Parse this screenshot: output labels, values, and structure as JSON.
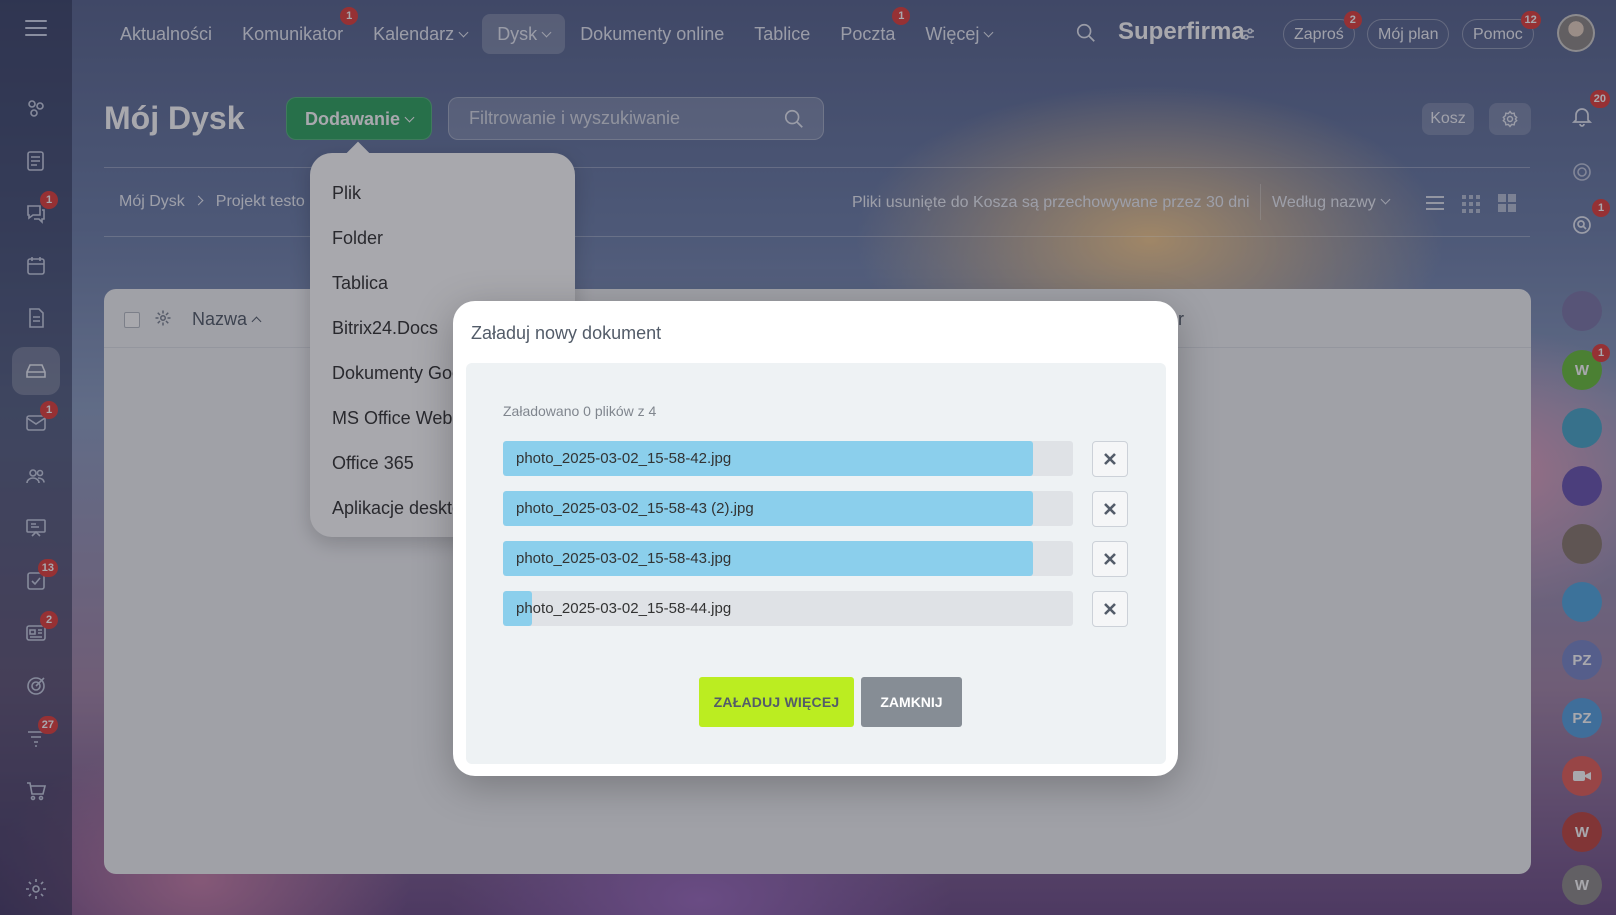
{
  "nav": {
    "items": [
      {
        "label": "Aktualności",
        "badge": ""
      },
      {
        "label": "Komunikator",
        "badge": "1"
      },
      {
        "label": "Kalendarz",
        "badge": ""
      },
      {
        "label": "Dysk",
        "badge": ""
      },
      {
        "label": "Dokumenty online",
        "badge": ""
      },
      {
        "label": "Tablice",
        "badge": ""
      },
      {
        "label": "Poczta",
        "badge": "1"
      },
      {
        "label": "Więcej",
        "badge": ""
      }
    ],
    "brand": "Superfirma",
    "invite": {
      "label": "Zaproś",
      "badge": "2"
    },
    "plan": {
      "label": "Mój plan"
    },
    "help": {
      "label": "Pomoc",
      "badge": "12"
    }
  },
  "left_sidebar": {
    "badges": {
      "chats": "1",
      "mail": "1",
      "tasks": "13",
      "news": "2",
      "filters": "27"
    }
  },
  "page": {
    "title": "Mój Dysk",
    "add_button": "Dodawanie",
    "filter_placeholder": "Filtrowanie i wyszukiwanie",
    "trash_button": "Kosz",
    "notifications_badge": "20",
    "breadcrumb": [
      "Mój Dysk",
      "Projekt testo"
    ],
    "trash_note": "Pliki usunięte do Kosza są przechowywane przez 30 dni",
    "sort_label": "Według nazwy"
  },
  "table": {
    "col_name": "Nazwa",
    "col_right": "iar"
  },
  "dropdown": {
    "items": [
      "Plik",
      "Folder",
      "Tablica",
      "Bitrix24.Docs",
      "Dokumenty Goo",
      "MS Office Web",
      "Office 365",
      "Aplikacje deskto"
    ]
  },
  "right_bar": {
    "chat_badge": "1",
    "avatar_badge": "1",
    "avatars": [
      "W",
      "PZ",
      "PZ",
      "W",
      "W"
    ]
  },
  "modal": {
    "title": "Załaduj nowy dokument",
    "status": "Załadowano 0 plików z 4",
    "files": [
      {
        "name": "photo_2025-03-02_15-58-42.jpg",
        "progress": 0.93
      },
      {
        "name": "photo_2025-03-02_15-58-43 (2).jpg",
        "progress": 0.93
      },
      {
        "name": "photo_2025-03-02_15-58-43.jpg",
        "progress": 0.93
      },
      {
        "name": "photo_2025-03-02_15-58-44.jpg",
        "progress": 0.05
      }
    ],
    "upload_more": "ZAŁADUJ WIĘCEJ",
    "close": "ZAMKNIJ"
  },
  "colors": {
    "primary_green": "#2fa560",
    "upload_more_bg": "#bbed21",
    "close_bg": "#868d95",
    "progress_fill": "#8bcfec",
    "badge_red": "#e2403d"
  }
}
